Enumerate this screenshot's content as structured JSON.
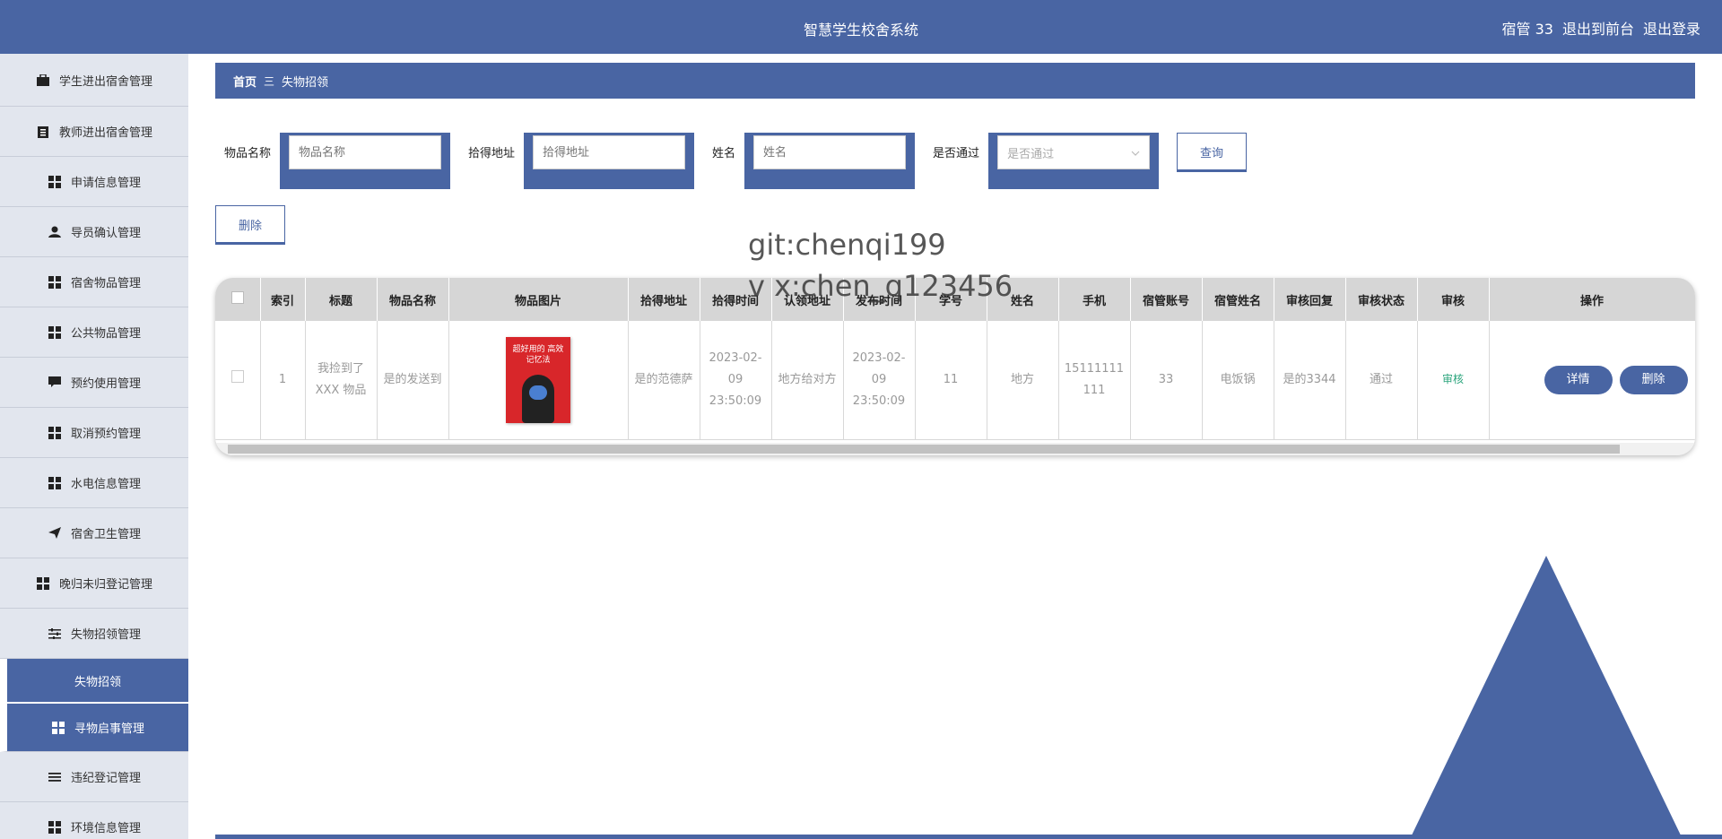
{
  "header": {
    "title": "智慧学生校舍系统",
    "user": "宿管 33",
    "front": "退出到前台",
    "logout": "退出登录"
  },
  "sidebar": {
    "items": [
      {
        "label": "学生进出宿舍管理",
        "icon": "briefcase-icon"
      },
      {
        "label": "教师进出宿舍管理",
        "icon": "clipboard-icon"
      },
      {
        "label": "申请信息管理",
        "icon": "grid-icon"
      },
      {
        "label": "导员确认管理",
        "icon": "user-icon"
      },
      {
        "label": "宿舍物品管理",
        "icon": "grid-icon"
      },
      {
        "label": "公共物品管理",
        "icon": "grid-icon"
      },
      {
        "label": "预约使用管理",
        "icon": "comment-icon"
      },
      {
        "label": "取消预约管理",
        "icon": "grid-icon"
      },
      {
        "label": "水电信息管理",
        "icon": "grid-icon"
      },
      {
        "label": "宿舍卫生管理",
        "icon": "paper-plane-icon"
      },
      {
        "label": "晚归未归登记管理",
        "icon": "grid-icon"
      },
      {
        "label": "失物招领管理",
        "icon": "sliders-icon"
      }
    ],
    "sub_item": "失物招领",
    "next_item": "寻物启事管理",
    "after_items": [
      {
        "label": "违纪登记管理",
        "icon": "list-icon"
      },
      {
        "label": "环境信息管理",
        "icon": "grid-icon"
      }
    ]
  },
  "breadcrumb": {
    "home": "首页",
    "sep": "三",
    "current": "失物招领"
  },
  "search": {
    "item_name_label": "物品名称",
    "item_name_placeholder": "物品名称",
    "address_label": "拾得地址",
    "address_placeholder": "拾得地址",
    "name_label": "姓名",
    "name_placeholder": "姓名",
    "pass_label": "是否通过",
    "pass_placeholder": "是否通过",
    "query": "查询"
  },
  "delete_button": "删除",
  "watermark": {
    "line1": "git:chenqi199",
    "line2": "v x:chen_q123456"
  },
  "table": {
    "headers": [
      "索引",
      "标题",
      "物品名称",
      "物品图片",
      "拾得地址",
      "拾得时间",
      "认领地址",
      "发布时间",
      "学号",
      "姓名",
      "手机",
      "宿管账号",
      "宿管姓名",
      "审核回复",
      "审核状态",
      "审核",
      "操作"
    ],
    "row": {
      "index": "1",
      "title": "我捡到了XXX 物品",
      "item_name": "是的发送到",
      "image_text": "超好用的 高效记忆法",
      "found_address": "是的范德萨",
      "found_time": "2023-02-09 23:50:09",
      "claim_address": "地方给对方",
      "publish_time": "2023-02-09 23:50:09",
      "student_no": "11",
      "name": "地方",
      "phone": "15111111111",
      "manager_account": "33",
      "manager_name": "电饭锅",
      "audit_reply": "是的3344",
      "audit_status": "通过",
      "audit_link": "审核",
      "detail": "详情",
      "delete": "删除"
    }
  },
  "colors": {
    "primary": "#4965a3",
    "audit_link": "#2ca57d"
  }
}
